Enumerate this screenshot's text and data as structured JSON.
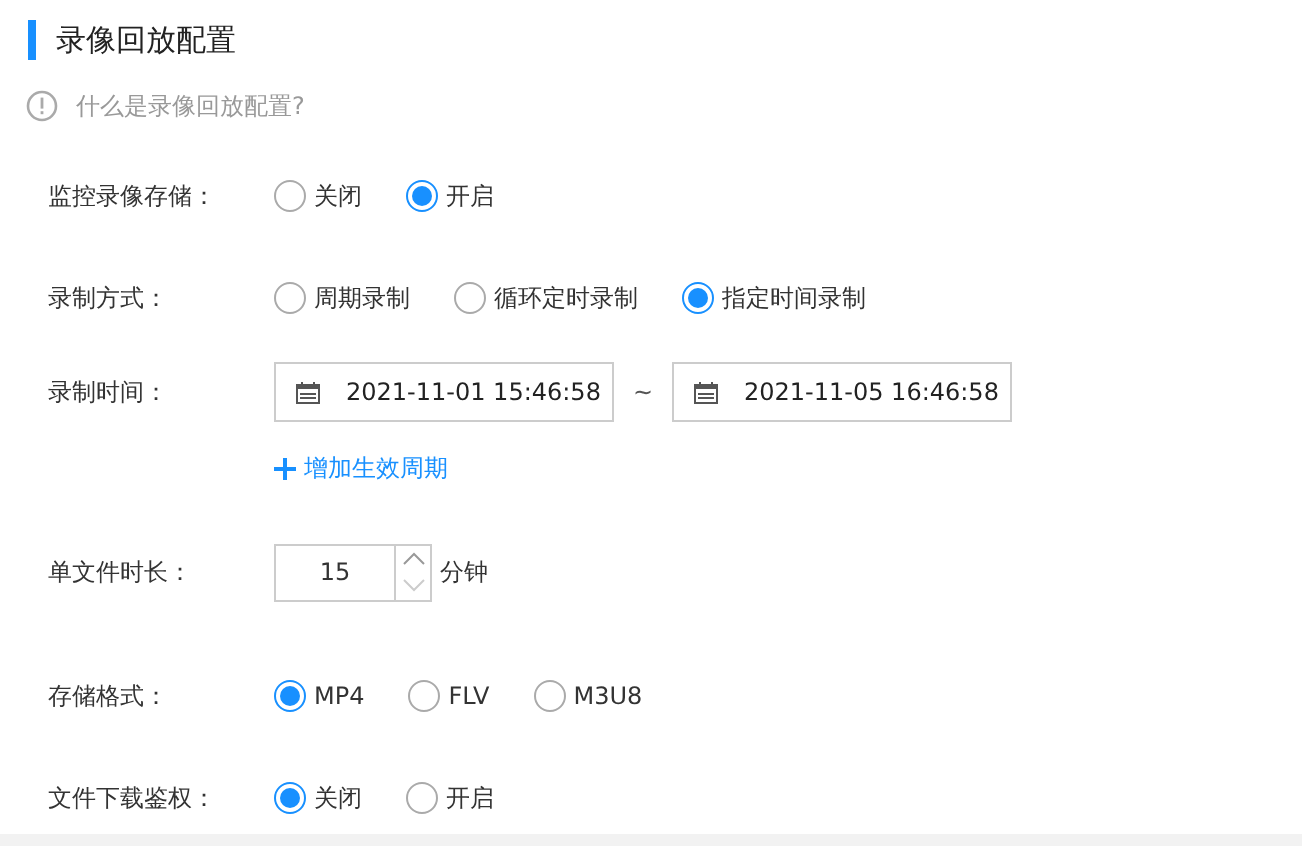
{
  "title": "录像回放配置",
  "help": "什么是录像回放配置?",
  "rows": [
    {
      "kind": "radio",
      "label": "监控录像存储：",
      "options": [
        {
          "label": "关闭",
          "selected": false
        },
        {
          "label": "开启",
          "selected": true
        }
      ]
    },
    {
      "kind": "radio",
      "label": "录制方式：",
      "options": [
        {
          "label": "周期录制",
          "selected": false
        },
        {
          "label": "循环定时录制",
          "selected": false
        },
        {
          "label": "指定时间录制",
          "selected": true
        }
      ]
    },
    {
      "kind": "daterange",
      "label": "录制时间：",
      "start": "2021-11-01 15:46:58",
      "separator": "~",
      "end": "2021-11-05 16:46:58",
      "add_link": "增加生效周期"
    },
    {
      "kind": "number",
      "label": "单文件时长：",
      "value": "15",
      "unit": "分钟"
    },
    {
      "kind": "radio",
      "label": "存储格式：",
      "options": [
        {
          "label": "MP4",
          "selected": true
        },
        {
          "label": "FLV",
          "selected": false
        },
        {
          "label": "M3U8",
          "selected": false
        }
      ]
    },
    {
      "kind": "radio",
      "label": "文件下载鉴权：",
      "options": [
        {
          "label": "关闭",
          "selected": true
        },
        {
          "label": "开启",
          "selected": false
        }
      ]
    }
  ]
}
